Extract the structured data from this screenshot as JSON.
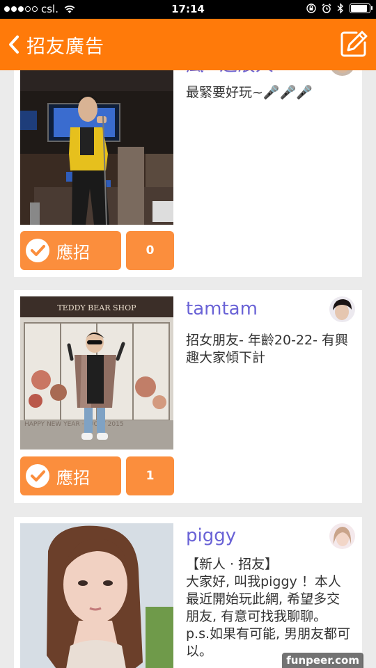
{
  "status_bar": {
    "carrier": "csl.",
    "time": "17:14",
    "signal_bars": 3,
    "battery_level": 0.9
  },
  "nav": {
    "title": "招友廣告",
    "back_icon": "chevron-left-icon",
    "compose_icon": "compose-icon"
  },
  "colors": {
    "brand_orange": "#ff7a0a",
    "button_orange": "#fb8e3d",
    "username_purple": "#6a63d6"
  },
  "posts": [
    {
      "username": "風~之浪人",
      "description": "最緊要好玩~🎤🎤🎤",
      "apply_label": "應招",
      "apply_count": "0"
    },
    {
      "username": "tamtam",
      "description": "招女朋友- 年齡20-22- 有興趣大家傾下計",
      "apply_label": "應招",
      "apply_count": "1"
    },
    {
      "username": "piggy",
      "description": "【新人 · 招友】\n大家好, 叫我piggy ！本人最近開始玩此網, 希望多交朋友, 有意可找我聊聊。\np.s.如果有可能, 男朋友都可以。"
    }
  ],
  "watermark": "funpeer.com"
}
